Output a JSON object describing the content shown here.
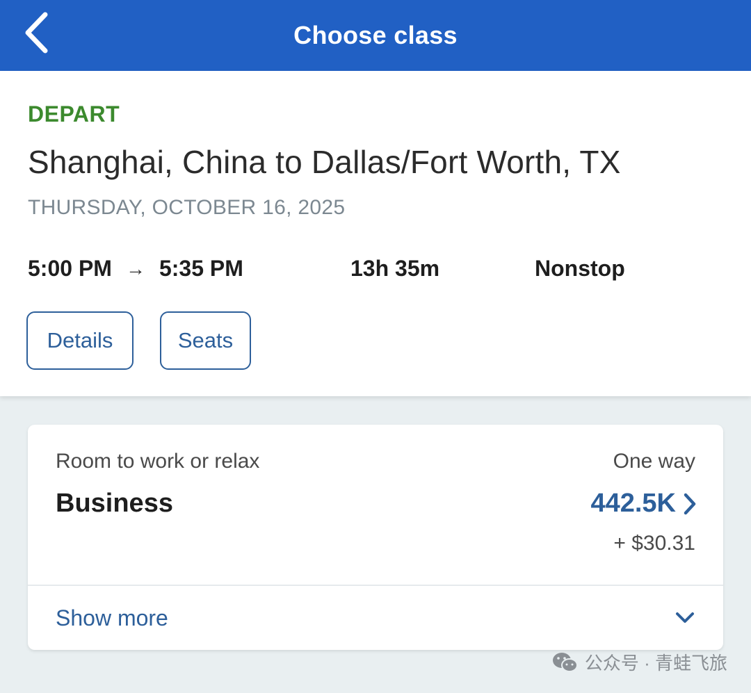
{
  "header": {
    "title": "Choose class",
    "back_icon": "chevron-left-icon",
    "background_color": "#2160c4"
  },
  "flight": {
    "direction_label": "DEPART",
    "route": "Shanghai, China to Dallas/Fort Worth, TX",
    "date": "THURSDAY, OCTOBER 16, 2025",
    "depart_time": "5:00 PM",
    "arrow": "→",
    "arrive_time": "5:35 PM",
    "duration": "13h 35m",
    "stops": "Nonstop",
    "buttons": {
      "details": "Details",
      "seats": "Seats"
    }
  },
  "fare": {
    "description": "Room to work or relax",
    "trip_type": "One way",
    "cabin": "Business",
    "miles": "442.5K",
    "taxes": "+ $30.31",
    "show_more": "Show more",
    "accent_color": "#2d5f9a"
  },
  "watermark": {
    "text": "公众号 · 青蛙飞旅",
    "icon": "wechat-icon"
  }
}
